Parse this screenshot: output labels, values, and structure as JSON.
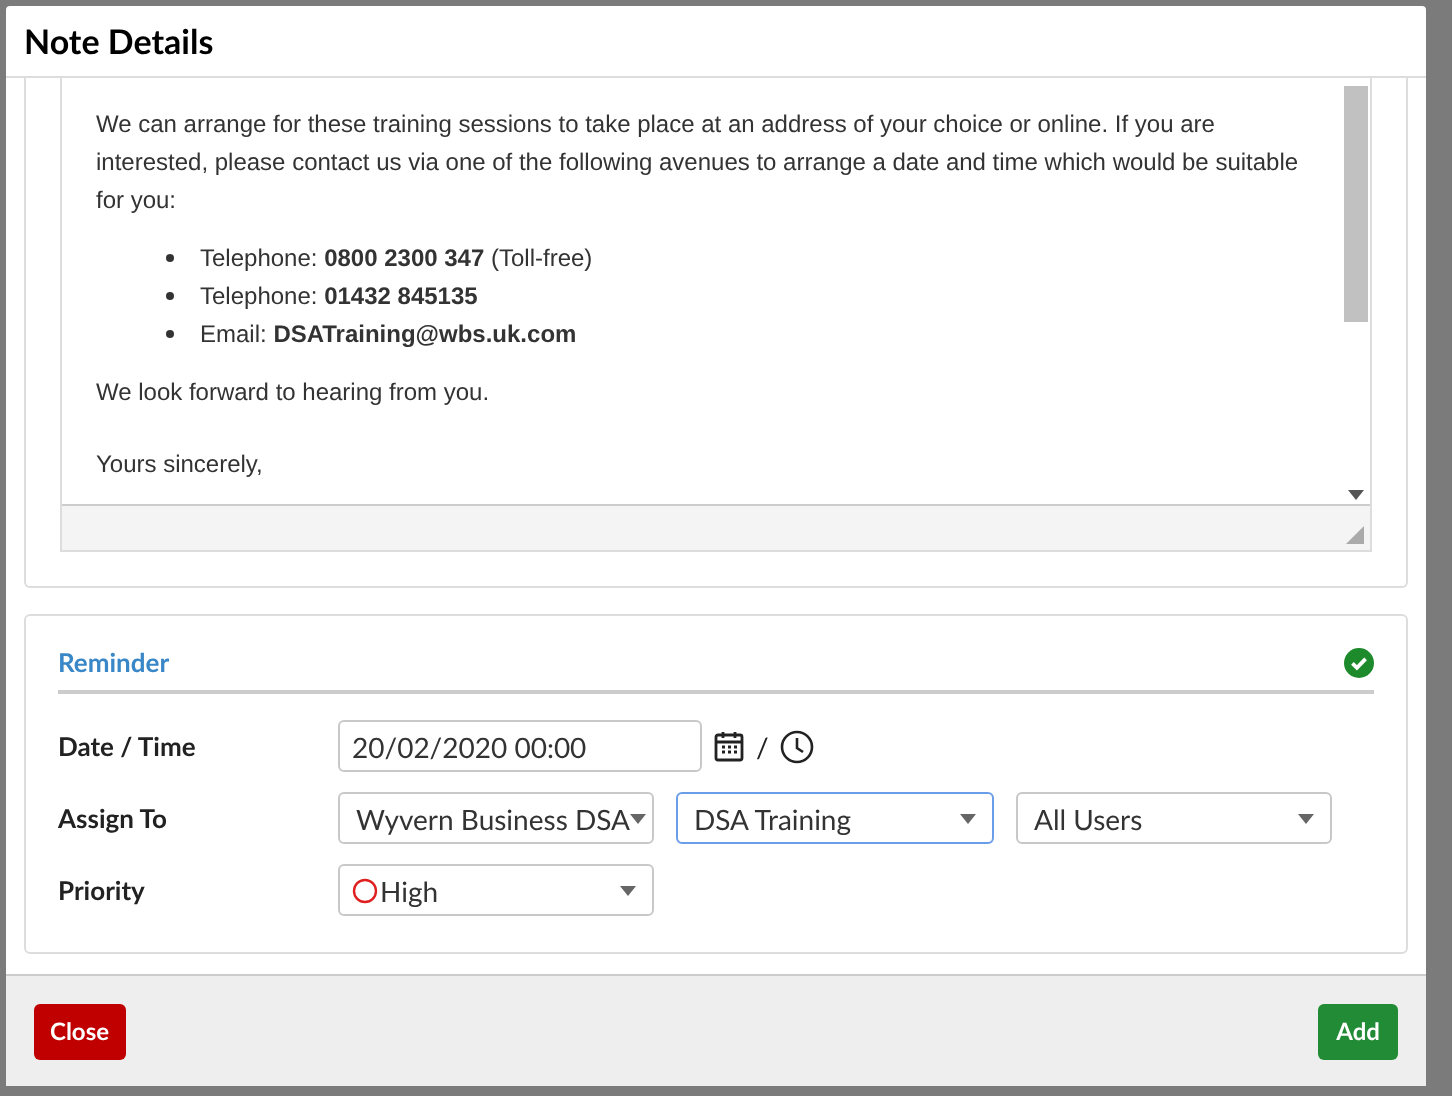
{
  "dialog": {
    "title": "Note Details"
  },
  "letter": {
    "paragraph": "We can arrange for these training sessions to take place at an address of your choice or online.  If you are interested, please contact us via one of the following avenues to arrange a date and time which would be suitable for you:",
    "contacts": [
      "Telephone: **0800 2300 347** (Toll-free)",
      "Telephone: **01432 845135**",
      "Email: **DSATraining@wbs.uk.com**"
    ],
    "closing": "We look forward to hearing from you.",
    "signoff": "Yours sincerely,"
  },
  "reminder": {
    "title": "Reminder",
    "complete": true,
    "date_time": {
      "label": "Date / Time",
      "value": "20/02/2020 00:00",
      "separator": "/"
    },
    "assign_to": {
      "label": "Assign To",
      "selects": [
        {
          "value": "Wyvern Business DSA",
          "focused": false
        },
        {
          "value": "DSA Training",
          "focused": true
        },
        {
          "value": "All Users",
          "focused": false
        }
      ]
    },
    "priority": {
      "label": "Priority",
      "value": "High"
    }
  },
  "buttons": {
    "close": "Close",
    "add": "Add"
  }
}
